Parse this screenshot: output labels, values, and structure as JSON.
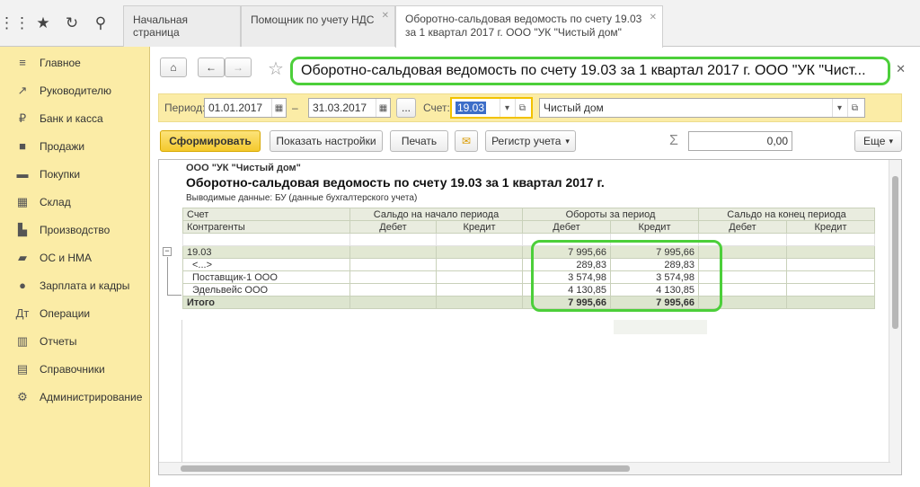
{
  "tabs": [
    {
      "label": "Начальная страница"
    },
    {
      "label": "Помощник по учету НДС"
    },
    {
      "label": "Оборотно-сальдовая ведомость по счету 19.03 за 1 квартал 2017 г. ООО \"УК \"Чистый дом\"",
      "line1": "Оборотно-сальдовая ведомость по счету 19.03",
      "line2": "за 1 квартал 2017 г. ООО \"УК \"Чистый дом\""
    }
  ],
  "sidebar": {
    "items": [
      {
        "label": "Главное",
        "icon": "menu-icon"
      },
      {
        "label": "Руководителю",
        "icon": "chart-icon"
      },
      {
        "label": "Банк и касса",
        "icon": "ruble-icon"
      },
      {
        "label": "Продажи",
        "icon": "bag-icon"
      },
      {
        "label": "Покупки",
        "icon": "cart-icon"
      },
      {
        "label": "Склад",
        "icon": "warehouse-icon"
      },
      {
        "label": "Производство",
        "icon": "factory-icon"
      },
      {
        "label": "ОС и НМА",
        "icon": "truck-icon"
      },
      {
        "label": "Зарплата и кадры",
        "icon": "person-icon"
      },
      {
        "label": "Операции",
        "icon": "operations-icon"
      },
      {
        "label": "Отчеты",
        "icon": "report-icon"
      },
      {
        "label": "Справочники",
        "icon": "book-icon"
      },
      {
        "label": "Администрирование",
        "icon": "gear-icon"
      }
    ]
  },
  "header": {
    "title": "Оборотно-сальдовая ведомость по счету 19.03 за 1 квартал 2017 г. ООО \"УК \"Чист..."
  },
  "params": {
    "period_label": "Период:",
    "date_from": "01.01.2017",
    "dash": "–",
    "date_to": "31.03.2017",
    "dots": "...",
    "account_label": "Счет:",
    "account": "19.03",
    "org": "Чистый дом"
  },
  "toolbar": {
    "generate": "Сформировать",
    "settings": "Показать настройки",
    "print": "Печать",
    "register": "Регистр учета",
    "sigma_value": "0,00",
    "more": "Еще"
  },
  "report": {
    "org": "ООО \"УК \"Чистый дом\"",
    "title": "Оборотно-сальдовая ведомость по счету 19.03 за 1 квартал 2017 г.",
    "output": "Выводимые данные:  БУ (данные бухгалтерского учета)",
    "col_account": "Счет",
    "col_contractors": "Контрагенты",
    "col_open": "Сальдо на начало периода",
    "col_turn": "Обороты за период",
    "col_close": "Сальдо на конец периода",
    "debit": "Дебет",
    "credit": "Кредит",
    "rows": [
      {
        "name": "19.03",
        "open_d": "",
        "open_c": "",
        "turn_d": "7 995,66",
        "turn_c": "7 995,66",
        "close_d": "",
        "close_c": ""
      },
      {
        "name": "<...>",
        "open_d": "",
        "open_c": "",
        "turn_d": "289,83",
        "turn_c": "289,83",
        "close_d": "",
        "close_c": ""
      },
      {
        "name": "Поставщик-1 ООО",
        "open_d": "",
        "open_c": "",
        "turn_d": "3 574,98",
        "turn_c": "3 574,98",
        "close_d": "",
        "close_c": ""
      },
      {
        "name": "Эдельвейс ООО",
        "open_d": "",
        "open_c": "",
        "turn_d": "4 130,85",
        "turn_c": "4 130,85",
        "close_d": "",
        "close_c": ""
      }
    ],
    "total": {
      "name": "Итого",
      "turn_d": "7 995,66",
      "turn_c": "7 995,66"
    }
  }
}
